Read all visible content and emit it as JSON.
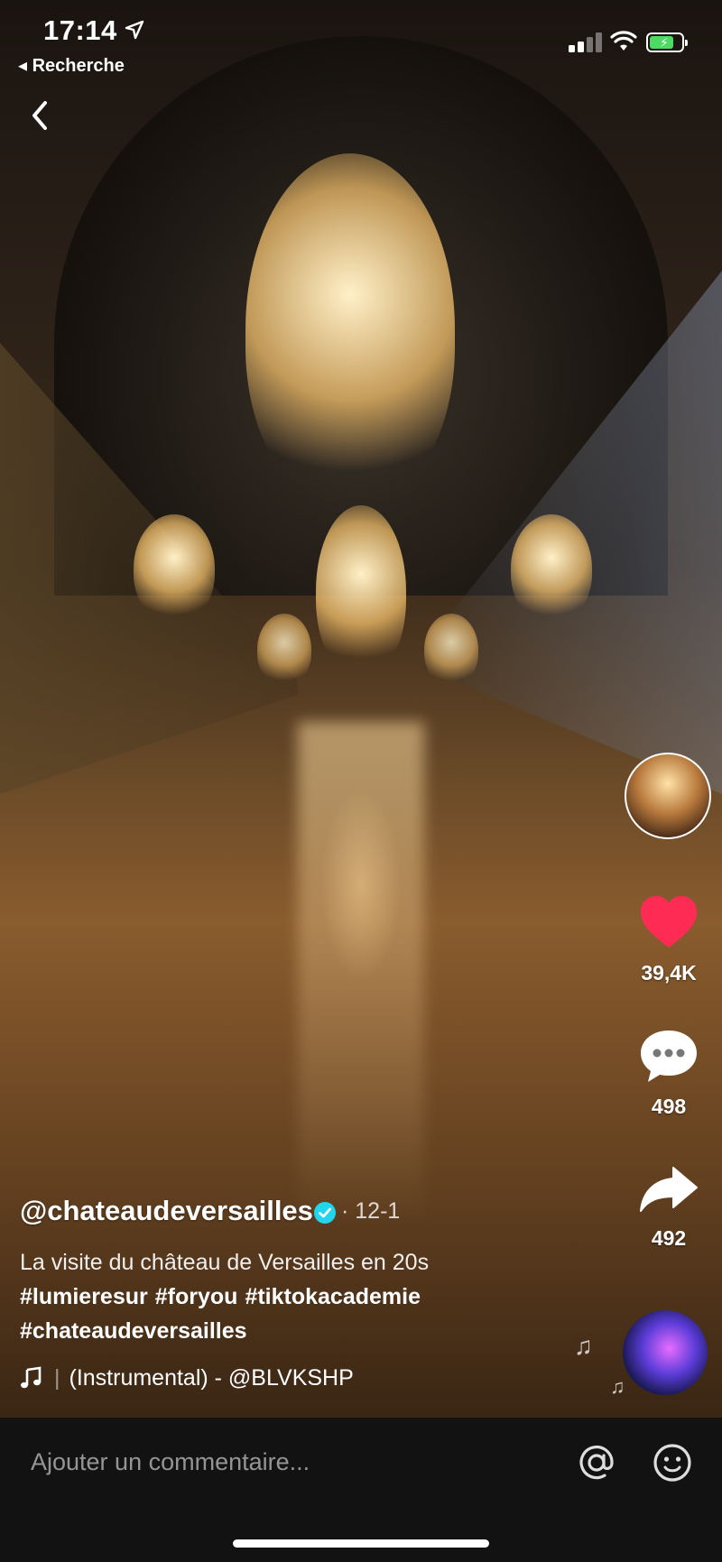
{
  "status_bar": {
    "time": "17:14",
    "location_icon": "location-arrow-icon",
    "back_app_label": "◂ Recherche",
    "signal_icon": "cellular-signal-icon",
    "wifi_icon": "wifi-icon",
    "battery_icon": "battery-charging-icon",
    "battery_color": "#4cd964"
  },
  "nav": {
    "back_icon": "chevron-left-icon"
  },
  "post": {
    "username": "@chateaudeversailles",
    "verified": true,
    "verified_color": "#20d5ec",
    "date": "· 12-1",
    "description": "La visite du château de Versailles en 20s",
    "hashtags": [
      "#lumieresur",
      "#foryou",
      "#tiktokacademie",
      "#chateaudeversailles"
    ],
    "music_icon": "music-note-icon",
    "music_title": "(Instrumental) - @BLVKSHP"
  },
  "actions": {
    "like_count": "39,4K",
    "like_color": "#fe2c55",
    "comment_count": "498",
    "share_count": "492"
  },
  "comment_bar": {
    "placeholder": "Ajouter un commentaire...",
    "mention_icon": "at-sign-icon",
    "emoji_icon": "emoji-icon"
  }
}
